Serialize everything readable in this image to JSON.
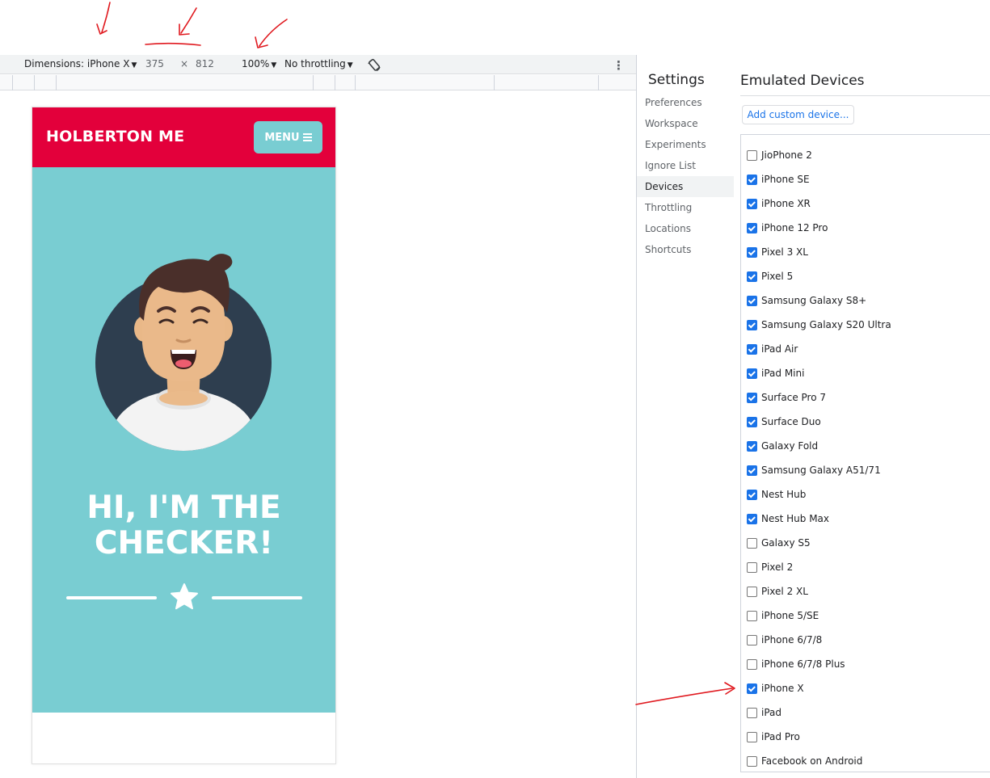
{
  "toolbar": {
    "dimensions_label": "Dimensions: iPhone X",
    "width": "375",
    "times": "×",
    "height": "812",
    "zoom": "100%",
    "throttling": "No throttling"
  },
  "site": {
    "brand": "HOLBERTON ME",
    "menu_label": "MENU",
    "hero_line1": "HI, I'M THE",
    "hero_line2": "CHECKER!"
  },
  "settings": {
    "title": "Settings",
    "nav": [
      "Preferences",
      "Workspace",
      "Experiments",
      "Ignore List",
      "Devices",
      "Throttling",
      "Locations",
      "Shortcuts"
    ],
    "active_nav": "Devices"
  },
  "devices": {
    "title": "Emulated Devices",
    "add_button": "Add custom device...",
    "list": [
      {
        "name": "JioPhone 2",
        "checked": false
      },
      {
        "name": "iPhone SE",
        "checked": true
      },
      {
        "name": "iPhone XR",
        "checked": true
      },
      {
        "name": "iPhone 12 Pro",
        "checked": true
      },
      {
        "name": "Pixel 3 XL",
        "checked": true
      },
      {
        "name": "Pixel 5",
        "checked": true
      },
      {
        "name": "Samsung Galaxy S8+",
        "checked": true
      },
      {
        "name": "Samsung Galaxy S20 Ultra",
        "checked": true
      },
      {
        "name": "iPad Air",
        "checked": true
      },
      {
        "name": "iPad Mini",
        "checked": true
      },
      {
        "name": "Surface Pro 7",
        "checked": true
      },
      {
        "name": "Surface Duo",
        "checked": true
      },
      {
        "name": "Galaxy Fold",
        "checked": true
      },
      {
        "name": "Samsung Galaxy A51/71",
        "checked": true
      },
      {
        "name": "Nest Hub",
        "checked": true
      },
      {
        "name": "Nest Hub Max",
        "checked": true
      },
      {
        "name": "Galaxy S5",
        "checked": false
      },
      {
        "name": "Pixel 2",
        "checked": false
      },
      {
        "name": "Pixel 2 XL",
        "checked": false
      },
      {
        "name": "iPhone 5/SE",
        "checked": false
      },
      {
        "name": "iPhone 6/7/8",
        "checked": false
      },
      {
        "name": "iPhone 6/7/8 Plus",
        "checked": false
      },
      {
        "name": "iPhone X",
        "checked": true
      },
      {
        "name": "iPad",
        "checked": false
      },
      {
        "name": "iPad Pro",
        "checked": false
      },
      {
        "name": "Facebook on Android",
        "checked": false
      }
    ]
  },
  "colors": {
    "nav_red": "#e3003b",
    "hero_teal": "#79cdd2",
    "checkbox_blue": "#1a73e8",
    "annotation_red": "#e0191f"
  },
  "icons": {
    "menu": "bars-icon",
    "rotate": "rotate-icon",
    "more": "more-vertical-icon",
    "divider": "star-icon"
  }
}
